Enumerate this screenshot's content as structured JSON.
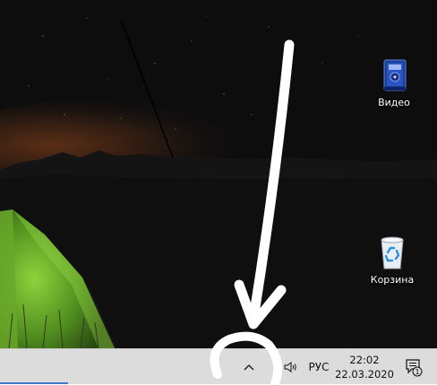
{
  "desktop": {
    "icons": [
      {
        "label": "Видео",
        "icon": "video-folder-icon"
      },
      {
        "label": "Корзина",
        "icon": "recycle-bin-icon"
      }
    ]
  },
  "taskbar": {
    "tray_chevron": "show-hidden-icons-chevron",
    "volume_icon": "speaker-icon",
    "language": "РУС",
    "time": "22:02",
    "date": "22.03.2020",
    "notification_count": "1"
  },
  "colors": {
    "taskbar_bg": "#dcdcdc",
    "accent": "#3b78c8",
    "annotation": "#ffffff"
  }
}
